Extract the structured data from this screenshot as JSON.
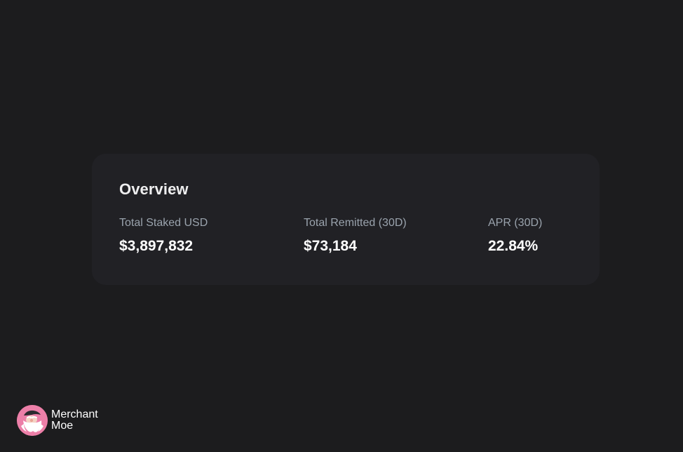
{
  "overview": {
    "title": "Overview",
    "stats": [
      {
        "label": "Total Staked USD",
        "value": "$3,897,832"
      },
      {
        "label": "Total Remitted (30D)",
        "value": "$73,184"
      },
      {
        "label": "APR (30D)",
        "value": "22.84%"
      }
    ]
  },
  "brand": {
    "name_line1": "Merchant",
    "name_line2": "Moe",
    "logo_icon": "merchant-moe-logo-icon",
    "logo_color": "#ec7fa8"
  },
  "colors": {
    "background": "#1c1c1e",
    "card": "#212125",
    "label": "#9aa3ad",
    "value": "#ffffff"
  }
}
